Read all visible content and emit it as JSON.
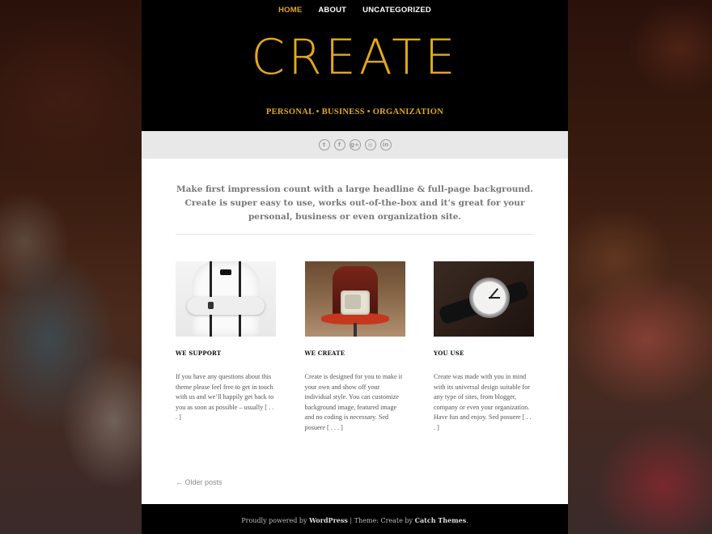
{
  "nav": {
    "items": [
      "HOME",
      "ABOUT",
      "UNCATEGORIZED"
    ],
    "active": "HOME"
  },
  "site": {
    "title": "CREATE",
    "tagline": "PERSONAL • BUSINESS • ORGANIZATION"
  },
  "social": {
    "icons": [
      "twitter-icon",
      "facebook-icon",
      "google-plus-icon",
      "instagram-icon",
      "linkedin-icon"
    ],
    "glyphs": [
      "t",
      "f",
      "g+",
      "◎",
      "in"
    ]
  },
  "intro": "Make first impression count with a large headline & full-page background. Create is super easy to use, works out-of-the-box and it’s great for your personal, business or even organization site.",
  "features": [
    {
      "title": "WE SUPPORT",
      "text": "If you have any questions about this theme please feel free to get in touch with us and we’ll happily get back to you as soon as possible – usually [ . . . ]"
    },
    {
      "title": "WE CREATE",
      "text": "Create is designed for you to make it your own and show off your individual style. You can customize background image, featured image and no coding is necessary. Sed posuere [ . . . ]"
    },
    {
      "title": "YOU USE",
      "text": "Create was made with you in mind with its universal design suitable for any type of sites, from blogger, company or even your organization. Have fun and enjoy. Sed posuere [ . . . ]"
    }
  ],
  "pagination": {
    "older": "← Older posts"
  },
  "footer": {
    "prefix": "Proudly powered by ",
    "wordpress": "WordPress",
    "separator": " | Theme: Create by ",
    "author": "Catch Themes",
    "suffix": "."
  },
  "colors": {
    "accent": "#e2a81d",
    "header_bg": "#000000",
    "social_bar_bg": "#e8e8e8"
  }
}
